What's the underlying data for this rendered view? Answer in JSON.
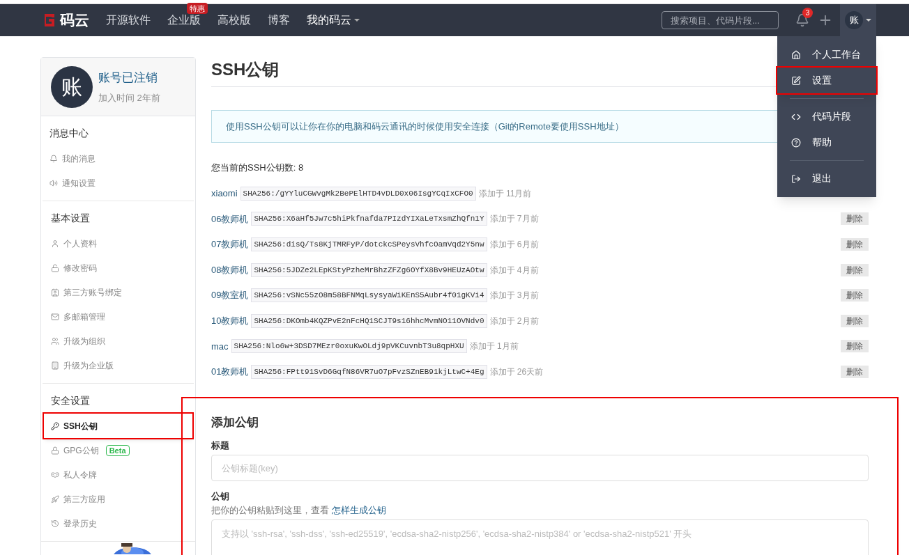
{
  "nav": {
    "logo": "码云",
    "links": [
      {
        "label": "开源软件"
      },
      {
        "label": "企业版",
        "badge": "特惠"
      },
      {
        "label": "高校版"
      },
      {
        "label": "博客"
      }
    ],
    "my": "我的码云",
    "search": {
      "placeholder": "搜索项目、代码片段..."
    },
    "notifications": "3",
    "avatar": "账"
  },
  "menu": {
    "items": [
      {
        "label": "个人工作台",
        "highlighted": false,
        "divider_after": false
      },
      {
        "label": "设置",
        "highlighted": true,
        "divider_after": true
      },
      {
        "label": "代码片段",
        "highlighted": false,
        "divider_after": false
      },
      {
        "label": "帮助",
        "highlighted": false,
        "divider_after": true
      },
      {
        "label": "退出",
        "highlighted": false,
        "divider_after": false
      }
    ]
  },
  "profile": {
    "avatar": "账",
    "name": "账号已注销",
    "joined": "加入时间 2年前"
  },
  "sidebar": [
    {
      "title": "消息中心",
      "items": [
        {
          "label": "我的消息",
          "selected": false,
          "highlighted": false
        },
        {
          "label": "通知设置",
          "selected": false,
          "highlighted": false
        }
      ]
    },
    {
      "title": "基本设置",
      "items": [
        {
          "label": "个人资料",
          "selected": false,
          "highlighted": false
        },
        {
          "label": "修改密码",
          "selected": false,
          "highlighted": false
        },
        {
          "label": "第三方账号绑定",
          "selected": false,
          "highlighted": false
        },
        {
          "label": "多邮箱管理",
          "selected": false,
          "highlighted": false
        },
        {
          "label": "升级为组织",
          "selected": false,
          "highlighted": false
        },
        {
          "label": "升级为企业版",
          "selected": false,
          "highlighted": false
        }
      ]
    },
    {
      "title": "安全设置",
      "items": [
        {
          "label": "SSH公钥",
          "selected": true,
          "highlighted": true
        },
        {
          "label": "GPG公钥",
          "badge": "Beta",
          "selected": false,
          "highlighted": false
        },
        {
          "label": "私人令牌",
          "selected": false,
          "highlighted": false
        },
        {
          "label": "第三方应用",
          "selected": false,
          "highlighted": false
        },
        {
          "label": "登录历史",
          "selected": false,
          "highlighted": false
        }
      ]
    }
  ],
  "page": {
    "title": "SSH公钥",
    "notice": "使用SSH公钥可以让你在你的电脑和码云通讯的时候使用安全连接（Git的Remote要使用SSH地址）",
    "count": "您当前的SSH公钥数: 8",
    "keys": [
      {
        "name": "xiaomi",
        "fingerprint": "SHA256:/gYYluCGWvgMk2BePElHTD4vDLD0x06IsgYCqIxCFO0",
        "added": "添加于 11月前"
      },
      {
        "name": "06教师机",
        "fingerprint": "SHA256:X6aHf5Jw7c5hiPkfnafda7PIzdYIXaLeTxsmZhQfn1Y",
        "added": "添加于 7月前",
        "delete": "删除"
      },
      {
        "name": "07教师机",
        "fingerprint": "SHA256:disQ/Ts8KjTMRFyP/dotckcSPeysVhfcOamVqd2Y5nw",
        "added": "添加于 6月前",
        "delete": "删除"
      },
      {
        "name": "08教师机",
        "fingerprint": "SHA256:5JDZe2LEpKStyPzheMrBhzZFZg6OYfX8Bv9HEUzAOtw",
        "added": "添加于 4月前",
        "delete": "删除"
      },
      {
        "name": "09教室机",
        "fingerprint": "SHA256:vSNc55zO8m58BFNMqLsysyaWiKEnS5Aubr4f01gKVi4",
        "added": "添加于 3月前",
        "delete": "删除"
      },
      {
        "name": "10教师机",
        "fingerprint": "SHA256:DKOmb4KQZPvE2nFcHQ1SCJT9s16hhcMvmNO11OVNdv0",
        "added": "添加于 2月前",
        "delete": "删除"
      },
      {
        "name": "mac",
        "fingerprint": "SHA256:Nlo6w+3DSD7MEzr0oxuKwOLdj9pVKCuvnbT3u8qpHXU",
        "added": "添加于 1月前",
        "delete": "删除"
      },
      {
        "name": "01教师机",
        "fingerprint": "SHA256:FPtt91SvD6GqfN86VR7uO7pFvzSZnEB91kjLtwC+4Eg",
        "added": "添加于 26天前",
        "delete": "删除"
      }
    ],
    "add": {
      "highlighted": true,
      "title": "添加公钥",
      "title_label": "标题",
      "title_placeholder": "公钥标题(key)",
      "key_label": "公钥",
      "hint": "把你的公钥粘贴到这里，查看 ",
      "hint_link": "怎样生成公钥",
      "key_placeholder": "支持以 'ssh-rsa', 'ssh-dss', 'ssh-ed25519', 'ecdsa-sha2-nistp256', 'ecdsa-sha2-nistp384' or 'ecdsa-sha2-nistp521' 开头"
    }
  }
}
